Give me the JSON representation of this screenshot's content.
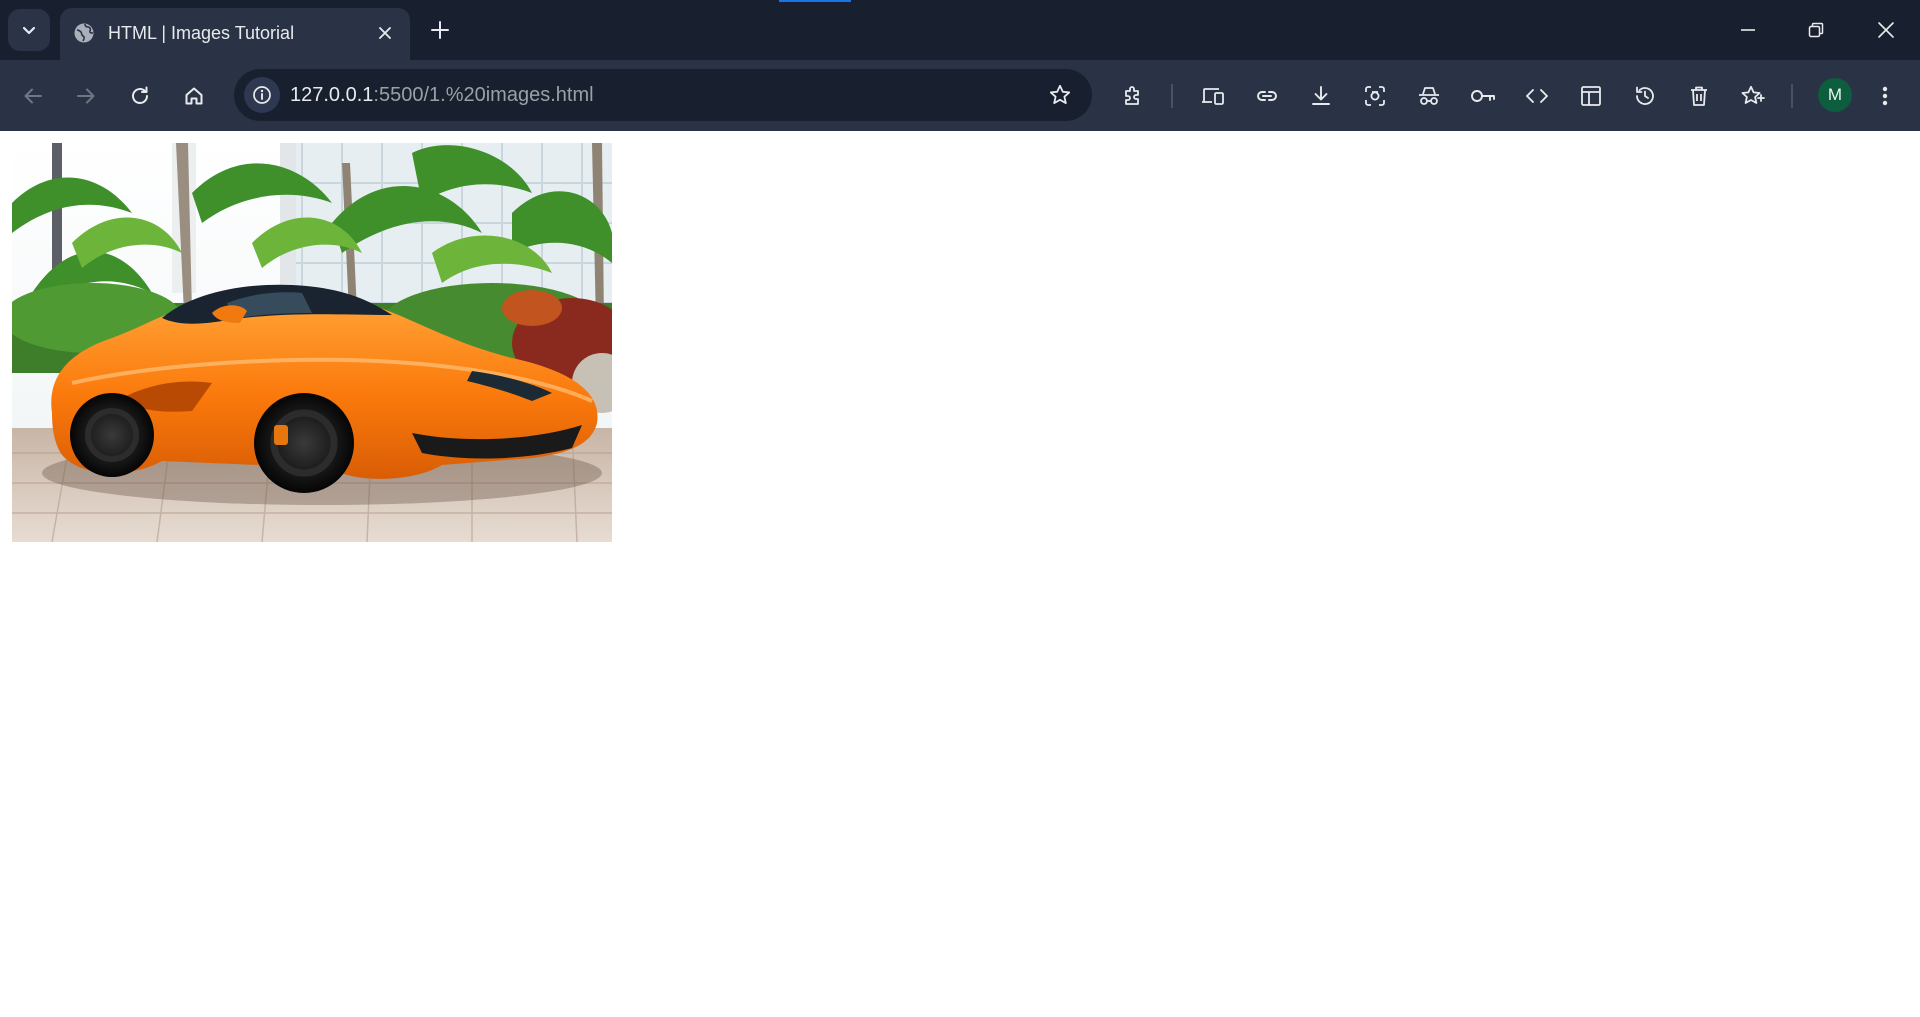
{
  "browser": {
    "active_tab": {
      "title": "HTML | Images Tutorial",
      "favicon": "globe-icon"
    },
    "omnibox": {
      "url_host": "127.0.0.1",
      "url_path": ":5500/1.%20images.html"
    },
    "toolbar_icons": [
      "back-icon",
      "forward-icon",
      "reload-icon",
      "home-icon",
      "site-info-icon",
      "bookmark-star-icon",
      "extensions-icon",
      "devices-icon",
      "link-icon",
      "download-icon",
      "screenshot-icon",
      "incognito-icon",
      "password-key-icon",
      "code-icon",
      "layout-icon",
      "history-icon",
      "delete-icon",
      "favorites-icon",
      "more-menu-icon"
    ],
    "profile_initial": "M",
    "colors": {
      "frame": "#18202f",
      "toolbar": "#2a3345",
      "loading_accent": "#1a73e8",
      "avatar": "#0d5d3f"
    }
  },
  "page": {
    "image": {
      "subject": "orange sports car parked in front of palm trees"
    }
  }
}
